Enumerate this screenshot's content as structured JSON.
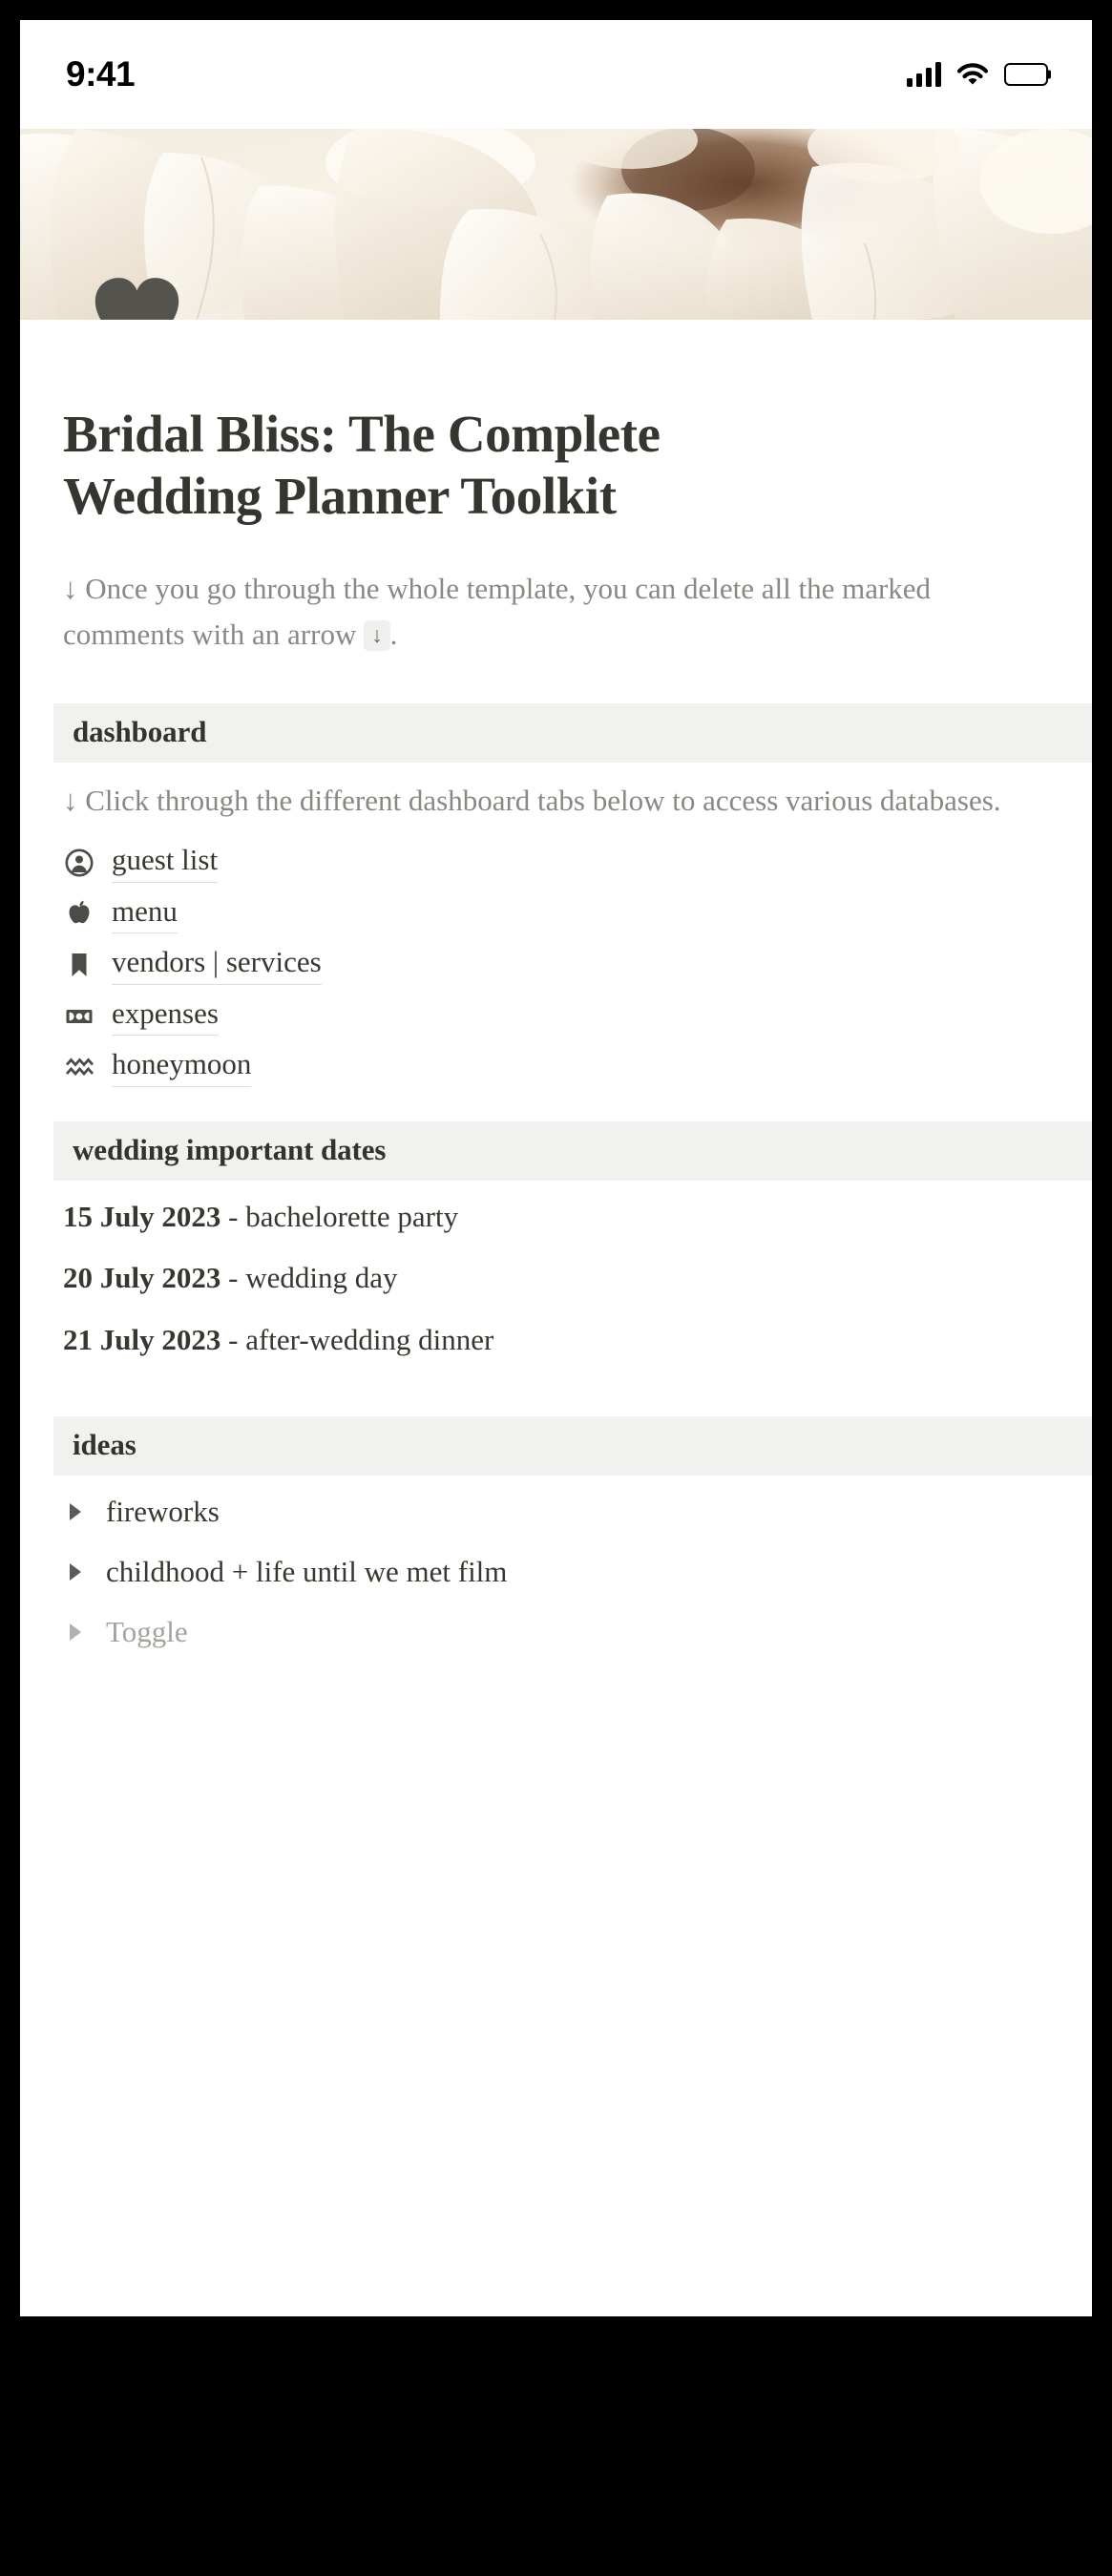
{
  "status_bar": {
    "time": "9:41",
    "signal_icon": "cellular-signal-icon",
    "wifi_icon": "wifi-icon",
    "battery_icon": "battery-full-icon"
  },
  "hero": {
    "image_description": "white peony flower petals close-up",
    "page_icon": "heart-icon"
  },
  "page": {
    "title": "Bridal Bliss: The Complete Wedding Planner Toolkit",
    "callout_before": "↓ Once you go through the whole template, you can delete all the marked comments with an arrow",
    "callout_chip": "↓",
    "callout_after": "."
  },
  "sections": {
    "dashboard": {
      "heading": "dashboard",
      "note": "↓ Click through the different dashboard tabs below to access various databases.",
      "links": [
        {
          "label": "guest list",
          "icon": "person-circle-icon"
        },
        {
          "label": "menu",
          "icon": "apple-icon"
        },
        {
          "label": "vendors | services",
          "icon": "bookmark-icon"
        },
        {
          "label": "expenses",
          "icon": "banknote-icon"
        },
        {
          "label": "honeymoon",
          "icon": "waves-icon"
        }
      ]
    },
    "important_dates": {
      "heading": "wedding important dates",
      "rows": [
        {
          "date": "15 July 2023",
          "separator": " - ",
          "event": "bachelorette party"
        },
        {
          "date": "20 July 2023",
          "separator": " - ",
          "event": "wedding day"
        },
        {
          "date": "21 July 2023",
          "separator": " - ",
          "event": "after-wedding dinner"
        }
      ]
    },
    "ideas": {
      "heading": "ideas",
      "toggles": [
        {
          "label": "fireworks",
          "placeholder": false
        },
        {
          "label": "childhood + life until we met film",
          "placeholder": false
        },
        {
          "label": "Toggle",
          "placeholder": true
        }
      ]
    }
  },
  "colors": {
    "text_primary": "#38372f",
    "text_muted": "#8a8883",
    "text_placeholder": "#a6a39e",
    "band_background": "#f1f1ef",
    "icon_dark": "#55534e",
    "link_underline": "#dedede"
  }
}
